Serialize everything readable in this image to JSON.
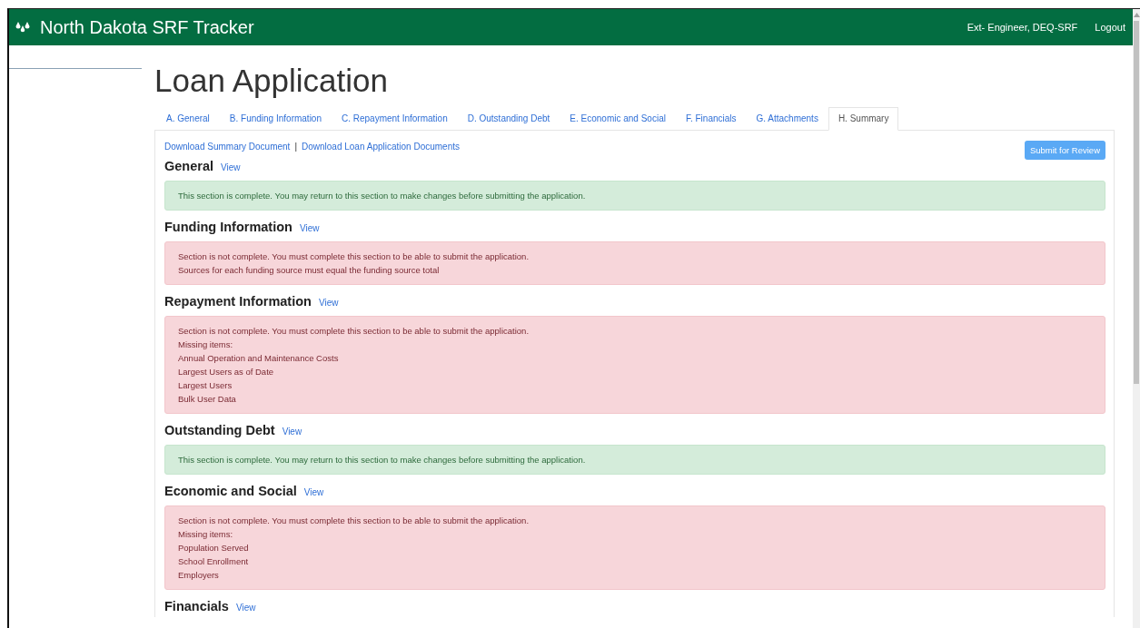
{
  "navbar": {
    "brand": "North Dakota SRF Tracker",
    "user": "Ext- Engineer, DEQ-SRF",
    "logout": "Logout"
  },
  "page_title": "Loan Application",
  "tabs": [
    {
      "label": "A. General",
      "selected": false
    },
    {
      "label": "B. Funding Information",
      "selected": false
    },
    {
      "label": "C. Repayment Information",
      "selected": false
    },
    {
      "label": "D. Outstanding Debt",
      "selected": false
    },
    {
      "label": "E. Economic and Social",
      "selected": false
    },
    {
      "label": "F. Financials",
      "selected": false
    },
    {
      "label": "G. Attachments",
      "selected": false
    },
    {
      "label": "H. Summary",
      "selected": true
    }
  ],
  "downloads": {
    "links": [
      "Download Summary Document",
      "Download Loan Application Documents"
    ],
    "separator": "|"
  },
  "submit_button": "Submit for Review",
  "sections": [
    {
      "title": "General",
      "link": "View",
      "kind": "complete",
      "lines": [
        "This section is complete. You may return to this section to make changes before submitting the application."
      ]
    },
    {
      "title": "Funding Information",
      "link": "View",
      "kind": "incomplete",
      "lines": [
        "Section is not complete. You must complete this section to be able to submit the application.",
        "Sources for each funding source must equal the funding source total"
      ]
    },
    {
      "title": "Repayment Information",
      "link": "View",
      "kind": "incomplete",
      "lines": [
        "Section is not complete. You must complete this section to be able to submit the application.",
        "Missing items:",
        "Annual Operation and Maintenance Costs",
        "Largest Users as of Date",
        "Largest Users",
        "Bulk User Data"
      ]
    },
    {
      "title": "Outstanding Debt",
      "link": "View",
      "kind": "complete",
      "lines": [
        "This section is complete. You may return to this section to make changes before submitting the application."
      ]
    },
    {
      "title": "Economic and Social",
      "link": "View",
      "kind": "incomplete",
      "lines": [
        "Section is not complete. You must complete this section to be able to submit the application.",
        "Missing items:",
        "Population Served",
        "School Enrollment",
        "Employers"
      ]
    },
    {
      "title": "Financials",
      "link": "View"
    }
  ]
}
